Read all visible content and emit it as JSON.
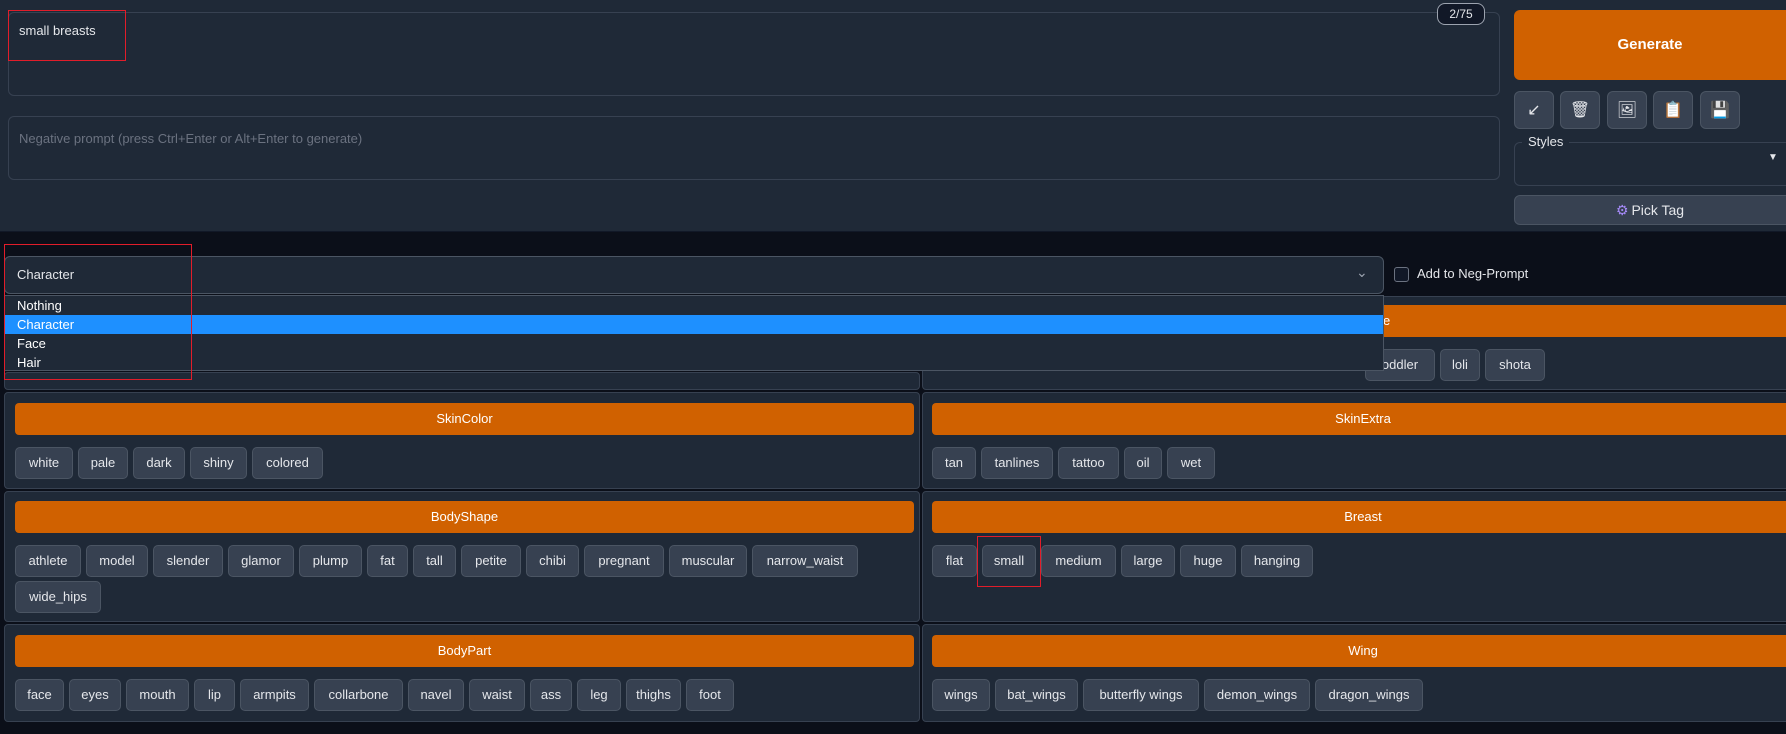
{
  "prompt": {
    "value": "small breasts",
    "token_counter": "2/75"
  },
  "negative_prompt": {
    "placeholder": "Negative prompt (press Ctrl+Enter or Alt+Enter to generate)"
  },
  "toolbar": {
    "generate_label": "Generate",
    "tools": [
      {
        "icon": "arrow-icon",
        "glyph": "↙"
      },
      {
        "icon": "trash-icon",
        "glyph": "🗑"
      },
      {
        "icon": "image-icon",
        "glyph": "🖼"
      },
      {
        "icon": "clipboard-icon",
        "glyph": "📋"
      },
      {
        "icon": "save-icon",
        "glyph": "💾"
      }
    ],
    "styles_label": "Styles",
    "pick_tag_label": "Pick Tag"
  },
  "category_select": {
    "selected": "Character",
    "options": [
      "Nothing",
      "Character",
      "Face",
      "Hair"
    ],
    "add_to_neg_label": "Add to Neg-Prompt"
  },
  "header_partial": "e",
  "row_partial_tags": [
    "oddler",
    "loli",
    "shota"
  ],
  "sections": {
    "skincolor": {
      "title": "SkinColor",
      "tags": [
        "white",
        "pale",
        "dark",
        "shiny",
        "colored"
      ]
    },
    "skinextra": {
      "title": "SkinExtra",
      "tags": [
        "tan",
        "tanlines",
        "tattoo",
        "oil",
        "wet"
      ]
    },
    "bodyshape": {
      "title": "BodyShape",
      "tags": [
        "athlete",
        "model",
        "slender",
        "glamor",
        "plump",
        "fat",
        "tall",
        "petite",
        "chibi",
        "pregnant",
        "muscular",
        "narrow_waist",
        "wide_hips"
      ]
    },
    "breast": {
      "title": "Breast",
      "tags": [
        "flat",
        "small",
        "medium",
        "large",
        "huge",
        "hanging"
      ]
    },
    "bodypart": {
      "title": "BodyPart",
      "tags": [
        "face",
        "eyes",
        "mouth",
        "lip",
        "armpits",
        "collarbone",
        "navel",
        "waist",
        "ass",
        "leg",
        "thighs",
        "foot"
      ]
    },
    "wing": {
      "title": "Wing",
      "tags": [
        "wings",
        "bat_wings",
        "butterfly wings",
        "demon_wings",
        "dragon_wings"
      ]
    }
  },
  "colors": {
    "accent": "#d06100",
    "selected_option": "#1e90ff",
    "highlight_box": "#e11d2a"
  }
}
